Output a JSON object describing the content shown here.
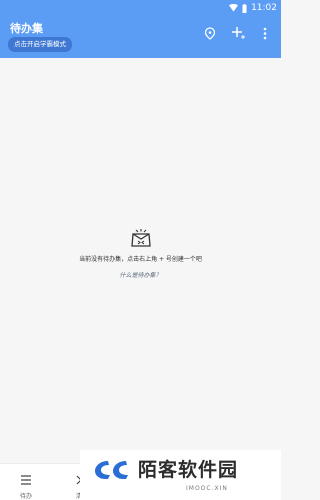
{
  "status": {
    "time": "11:02"
  },
  "header": {
    "title": "待办集",
    "mode_button": "点击开启学霸模式"
  },
  "icons": {
    "location": "location-pin-icon",
    "add": "add-icon",
    "more": "more-vert-icon",
    "empty": "inbox-icon"
  },
  "empty_state": {
    "message": "当前没有待办集，点击右上角 + 号创建一个吧",
    "link": "什么是待办集？"
  },
  "bottom_nav": {
    "item1_label": "待办",
    "item2_label": "清"
  },
  "watermark": {
    "title": "陌客软件园",
    "subtitle": "IMOOC.XIN"
  },
  "colors": {
    "primary": "#5b9df5",
    "button": "#3f78d2",
    "background": "#f6f6f6"
  }
}
